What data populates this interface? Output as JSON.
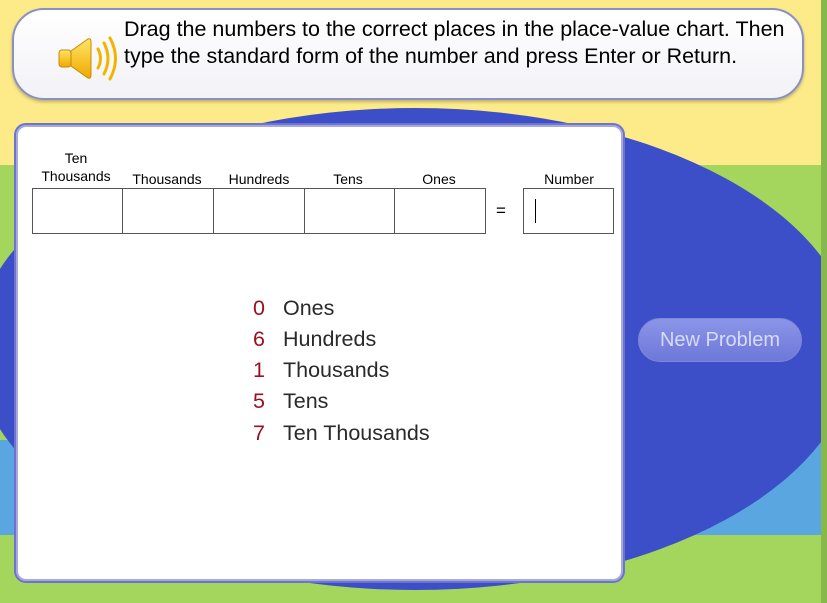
{
  "instructions": {
    "text": "Drag the numbers to the correct places in the place-value chart. Then type the standard form of the number and press Enter or Return.",
    "icon": "speaker-icon"
  },
  "chart": {
    "headers": {
      "ten_thousands_line1": "Ten",
      "ten_thousands_line2": "Thousands",
      "thousands": "Thousands",
      "hundreds": "Hundreds",
      "tens": "Tens",
      "ones": "Ones",
      "number": "Number"
    },
    "equals": "=",
    "number_value": ""
  },
  "tiles": [
    {
      "digit": "0",
      "place": "Ones"
    },
    {
      "digit": "6",
      "place": "Hundreds"
    },
    {
      "digit": "1",
      "place": "Thousands"
    },
    {
      "digit": "5",
      "place": "Tens"
    },
    {
      "digit": "7",
      "place": "Ten Thousands"
    }
  ],
  "new_problem_label": "New Problem",
  "colors": {
    "digit": "#9B1020",
    "background_blue": "#3D4FC8",
    "background_green": "#A4D65E",
    "background_yellow": "#FDEB8A",
    "button": "#7A84DE"
  }
}
